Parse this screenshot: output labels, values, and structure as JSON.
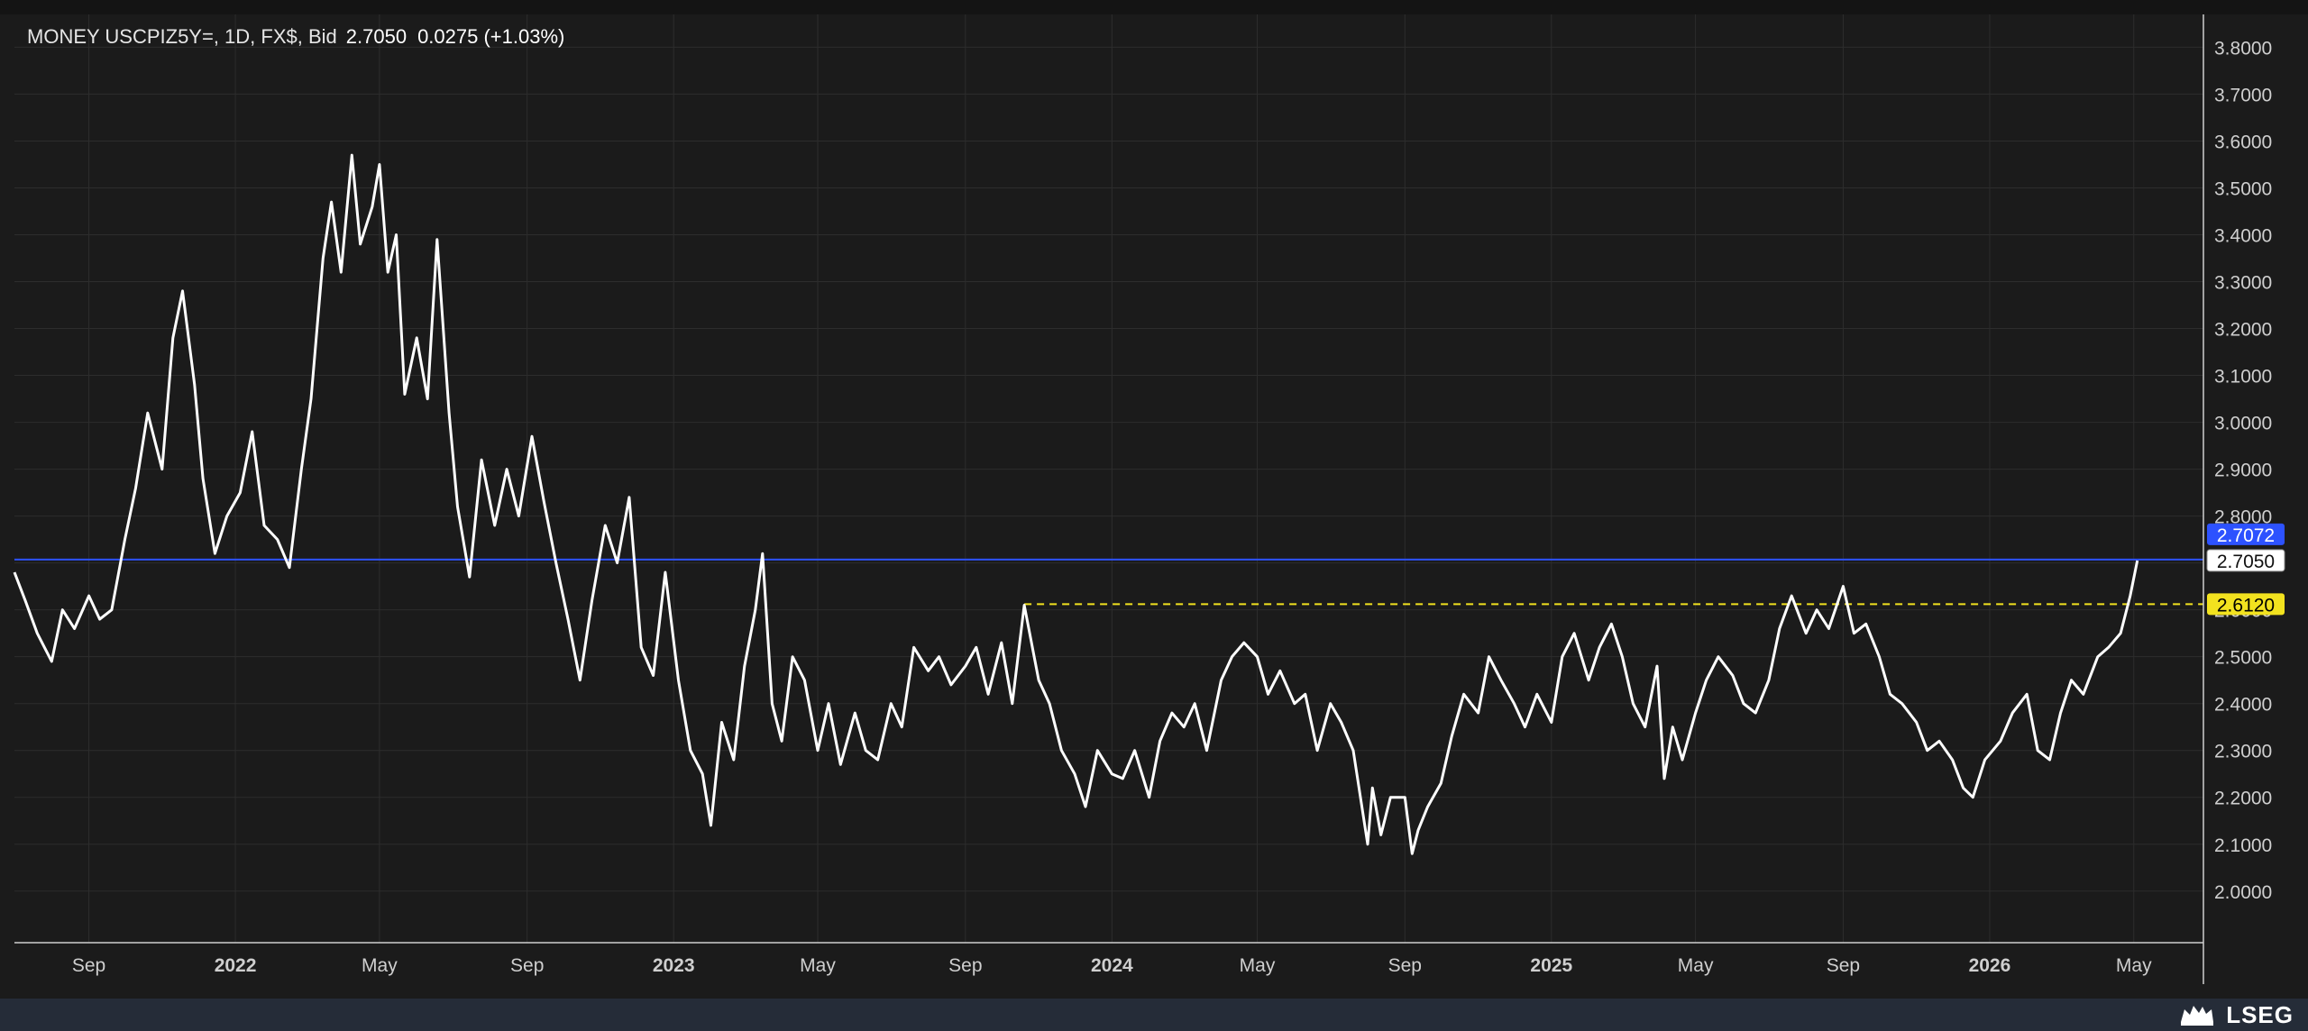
{
  "header": {
    "label": "MONEY USCPIZ5Y=, 1D, FX$, Bid",
    "value": "2.7050",
    "change": "0.0275 (+1.03%)"
  },
  "brand": {
    "name": "LSEG"
  },
  "colors": {
    "background": "#1b1b1b",
    "grid": "#2d2d2d",
    "series": "#ffffff",
    "ref_line": "#2d52ff",
    "ref_dash": "#f2e21f",
    "footer": "#252c38"
  },
  "chart_data": {
    "type": "line",
    "title": "MONEY USCPIZ5Y=, 1D, FX$, Bid",
    "xlabel": "",
    "ylabel": "",
    "xlim": [
      "2021-07-01",
      "2026-06-28"
    ],
    "ylim": [
      1.89,
      3.87
    ],
    "y_ticks": [
      "2.0000",
      "2.1000",
      "2.2000",
      "2.3000",
      "2.4000",
      "2.5000",
      "2.6000",
      "2.7000",
      "2.8000",
      "2.9000",
      "3.0000",
      "3.1000",
      "3.2000",
      "3.3000",
      "3.4000",
      "3.5000",
      "3.6000",
      "3.7000",
      "3.8000"
    ],
    "x_ticks": [
      {
        "label": "Sep",
        "date": "2021-09-01",
        "bold": false
      },
      {
        "label": "2022",
        "date": "2022-01-01",
        "bold": true
      },
      {
        "label": "May",
        "date": "2022-05-01",
        "bold": false
      },
      {
        "label": "Sep",
        "date": "2022-09-01",
        "bold": false
      },
      {
        "label": "2023",
        "date": "2023-01-01",
        "bold": true
      },
      {
        "label": "May",
        "date": "2023-05-01",
        "bold": false
      },
      {
        "label": "Sep",
        "date": "2023-09-01",
        "bold": false
      },
      {
        "label": "2024",
        "date": "2024-01-01",
        "bold": true
      },
      {
        "label": "May",
        "date": "2024-05-01",
        "bold": false
      },
      {
        "label": "Sep",
        "date": "2024-09-01",
        "bold": false
      },
      {
        "label": "2025",
        "date": "2025-01-01",
        "bold": true
      },
      {
        "label": "May",
        "date": "2025-05-01",
        "bold": false
      },
      {
        "label": "Sep",
        "date": "2025-09-01",
        "bold": false
      },
      {
        "label": "2026",
        "date": "2026-01-01",
        "bold": true
      },
      {
        "label": "May",
        "date": "2026-05-01",
        "bold": false
      }
    ],
    "grid": true,
    "reference_lines": [
      {
        "value": 2.7072,
        "label": "2.7072",
        "style": "solid",
        "color": "#2d52ff",
        "tag_bg": "#2d52ff",
        "tag_fg": "#ffffff",
        "from": "2021-07-01"
      },
      {
        "value": 2.612,
        "label": "2.6120",
        "style": "dashed",
        "color": "#f2e21f",
        "tag_bg": "#f2e21f",
        "tag_fg": "#000000",
        "from": "2023-10-20"
      }
    ],
    "last_price": {
      "value": 2.705,
      "label": "2.7050"
    },
    "series": [
      {
        "values": [
          [
            "2021-07-01",
            2.68
          ],
          [
            "2021-07-10",
            2.62
          ],
          [
            "2021-07-20",
            2.55
          ],
          [
            "2021-08-01",
            2.49
          ],
          [
            "2021-08-10",
            2.6
          ],
          [
            "2021-08-20",
            2.56
          ],
          [
            "2021-09-01",
            2.63
          ],
          [
            "2021-09-10",
            2.58
          ],
          [
            "2021-09-20",
            2.6
          ],
          [
            "2021-10-01",
            2.75
          ],
          [
            "2021-10-10",
            2.86
          ],
          [
            "2021-10-20",
            3.02
          ],
          [
            "2021-11-01",
            2.9
          ],
          [
            "2021-11-10",
            3.18
          ],
          [
            "2021-11-18",
            3.28
          ],
          [
            "2021-11-28",
            3.08
          ],
          [
            "2021-12-05",
            2.88
          ],
          [
            "2021-12-15",
            2.72
          ],
          [
            "2021-12-25",
            2.8
          ],
          [
            "2022-01-05",
            2.85
          ],
          [
            "2022-01-15",
            2.98
          ],
          [
            "2022-01-25",
            2.78
          ],
          [
            "2022-02-05",
            2.75
          ],
          [
            "2022-02-15",
            2.69
          ],
          [
            "2022-02-25",
            2.9
          ],
          [
            "2022-03-05",
            3.05
          ],
          [
            "2022-03-15",
            3.35
          ],
          [
            "2022-03-22",
            3.47
          ],
          [
            "2022-03-30",
            3.32
          ],
          [
            "2022-04-08",
            3.57
          ],
          [
            "2022-04-15",
            3.38
          ],
          [
            "2022-04-25",
            3.46
          ],
          [
            "2022-05-01",
            3.55
          ],
          [
            "2022-05-08",
            3.32
          ],
          [
            "2022-05-15",
            3.4
          ],
          [
            "2022-05-22",
            3.06
          ],
          [
            "2022-06-01",
            3.18
          ],
          [
            "2022-06-10",
            3.05
          ],
          [
            "2022-06-18",
            3.39
          ],
          [
            "2022-06-28",
            3.02
          ],
          [
            "2022-07-05",
            2.82
          ],
          [
            "2022-07-15",
            2.67
          ],
          [
            "2022-07-25",
            2.92
          ],
          [
            "2022-08-05",
            2.78
          ],
          [
            "2022-08-15",
            2.9
          ],
          [
            "2022-08-25",
            2.8
          ],
          [
            "2022-09-05",
            2.97
          ],
          [
            "2022-09-15",
            2.83
          ],
          [
            "2022-09-25",
            2.7
          ],
          [
            "2022-10-05",
            2.58
          ],
          [
            "2022-10-15",
            2.45
          ],
          [
            "2022-10-25",
            2.62
          ],
          [
            "2022-11-05",
            2.78
          ],
          [
            "2022-11-15",
            2.7
          ],
          [
            "2022-11-25",
            2.84
          ],
          [
            "2022-12-05",
            2.52
          ],
          [
            "2022-12-15",
            2.46
          ],
          [
            "2022-12-25",
            2.68
          ],
          [
            "2023-01-05",
            2.45
          ],
          [
            "2023-01-15",
            2.3
          ],
          [
            "2023-01-25",
            2.25
          ],
          [
            "2023-02-01",
            2.14
          ],
          [
            "2023-02-10",
            2.36
          ],
          [
            "2023-02-20",
            2.28
          ],
          [
            "2023-03-01",
            2.48
          ],
          [
            "2023-03-10",
            2.6
          ],
          [
            "2023-03-16",
            2.72
          ],
          [
            "2023-03-24",
            2.4
          ],
          [
            "2023-04-01",
            2.32
          ],
          [
            "2023-04-10",
            2.5
          ],
          [
            "2023-04-20",
            2.45
          ],
          [
            "2023-05-01",
            2.3
          ],
          [
            "2023-05-10",
            2.4
          ],
          [
            "2023-05-20",
            2.27
          ],
          [
            "2023-06-01",
            2.38
          ],
          [
            "2023-06-10",
            2.3
          ],
          [
            "2023-06-20",
            2.28
          ],
          [
            "2023-07-01",
            2.4
          ],
          [
            "2023-07-10",
            2.35
          ],
          [
            "2023-07-20",
            2.52
          ],
          [
            "2023-08-01",
            2.47
          ],
          [
            "2023-08-10",
            2.5
          ],
          [
            "2023-08-20",
            2.44
          ],
          [
            "2023-09-01",
            2.48
          ],
          [
            "2023-09-10",
            2.52
          ],
          [
            "2023-09-20",
            2.42
          ],
          [
            "2023-10-01",
            2.53
          ],
          [
            "2023-10-10",
            2.4
          ],
          [
            "2023-10-20",
            2.61
          ],
          [
            "2023-11-01",
            2.45
          ],
          [
            "2023-11-10",
            2.4
          ],
          [
            "2023-11-20",
            2.3
          ],
          [
            "2023-12-01",
            2.25
          ],
          [
            "2023-12-10",
            2.18
          ],
          [
            "2023-12-20",
            2.3
          ],
          [
            "2024-01-01",
            2.25
          ],
          [
            "2024-01-10",
            2.24
          ],
          [
            "2024-01-20",
            2.3
          ],
          [
            "2024-02-01",
            2.2
          ],
          [
            "2024-02-10",
            2.32
          ],
          [
            "2024-02-20",
            2.38
          ],
          [
            "2024-03-01",
            2.35
          ],
          [
            "2024-03-10",
            2.4
          ],
          [
            "2024-03-20",
            2.3
          ],
          [
            "2024-04-01",
            2.45
          ],
          [
            "2024-04-10",
            2.5
          ],
          [
            "2024-04-20",
            2.53
          ],
          [
            "2024-05-01",
            2.5
          ],
          [
            "2024-05-10",
            2.42
          ],
          [
            "2024-05-20",
            2.47
          ],
          [
            "2024-06-01",
            2.4
          ],
          [
            "2024-06-10",
            2.42
          ],
          [
            "2024-06-20",
            2.3
          ],
          [
            "2024-07-01",
            2.4
          ],
          [
            "2024-07-10",
            2.36
          ],
          [
            "2024-07-20",
            2.3
          ],
          [
            "2024-08-01",
            2.1
          ],
          [
            "2024-08-05",
            2.22
          ],
          [
            "2024-08-12",
            2.12
          ],
          [
            "2024-08-20",
            2.2
          ],
          [
            "2024-09-01",
            2.2
          ],
          [
            "2024-09-07",
            2.08
          ],
          [
            "2024-09-12",
            2.13
          ],
          [
            "2024-09-20",
            2.18
          ],
          [
            "2024-10-01",
            2.23
          ],
          [
            "2024-10-10",
            2.33
          ],
          [
            "2024-10-20",
            2.42
          ],
          [
            "2024-11-01",
            2.38
          ],
          [
            "2024-11-10",
            2.5
          ],
          [
            "2024-11-20",
            2.45
          ],
          [
            "2024-12-01",
            2.4
          ],
          [
            "2024-12-10",
            2.35
          ],
          [
            "2024-12-20",
            2.42
          ],
          [
            "2025-01-01",
            2.36
          ],
          [
            "2025-01-10",
            2.5
          ],
          [
            "2025-01-20",
            2.55
          ],
          [
            "2025-02-01",
            2.45
          ],
          [
            "2025-02-10",
            2.52
          ],
          [
            "2025-02-20",
            2.57
          ],
          [
            "2025-03-01",
            2.5
          ],
          [
            "2025-03-10",
            2.4
          ],
          [
            "2025-03-20",
            2.35
          ],
          [
            "2025-03-30",
            2.48
          ],
          [
            "2025-04-05",
            2.24
          ],
          [
            "2025-04-12",
            2.35
          ],
          [
            "2025-04-20",
            2.28
          ],
          [
            "2025-05-01",
            2.38
          ],
          [
            "2025-05-10",
            2.45
          ],
          [
            "2025-05-20",
            2.5
          ],
          [
            "2025-06-01",
            2.46
          ],
          [
            "2025-06-10",
            2.4
          ],
          [
            "2025-06-20",
            2.38
          ],
          [
            "2025-07-01",
            2.45
          ],
          [
            "2025-07-10",
            2.56
          ],
          [
            "2025-07-20",
            2.63
          ],
          [
            "2025-08-01",
            2.55
          ],
          [
            "2025-08-10",
            2.6
          ],
          [
            "2025-08-20",
            2.56
          ],
          [
            "2025-09-01",
            2.65
          ],
          [
            "2025-09-10",
            2.55
          ],
          [
            "2025-09-20",
            2.57
          ],
          [
            "2025-10-01",
            2.5
          ],
          [
            "2025-10-10",
            2.42
          ],
          [
            "2025-10-20",
            2.4
          ],
          [
            "2025-11-01",
            2.36
          ],
          [
            "2025-11-10",
            2.3
          ],
          [
            "2025-11-20",
            2.32
          ],
          [
            "2025-12-01",
            2.28
          ],
          [
            "2025-12-10",
            2.22
          ],
          [
            "2025-12-18",
            2.2
          ],
          [
            "2025-12-28",
            2.28
          ],
          [
            "2026-01-10",
            2.32
          ],
          [
            "2026-01-20",
            2.38
          ],
          [
            "2026-02-01",
            2.42
          ],
          [
            "2026-02-10",
            2.3
          ],
          [
            "2026-02-20",
            2.28
          ],
          [
            "2026-03-01",
            2.38
          ],
          [
            "2026-03-10",
            2.45
          ],
          [
            "2026-03-20",
            2.42
          ],
          [
            "2026-04-01",
            2.5
          ],
          [
            "2026-04-10",
            2.52
          ],
          [
            "2026-04-20",
            2.55
          ],
          [
            "2026-04-28",
            2.63
          ],
          [
            "2026-05-04",
            2.705
          ]
        ]
      }
    ]
  }
}
